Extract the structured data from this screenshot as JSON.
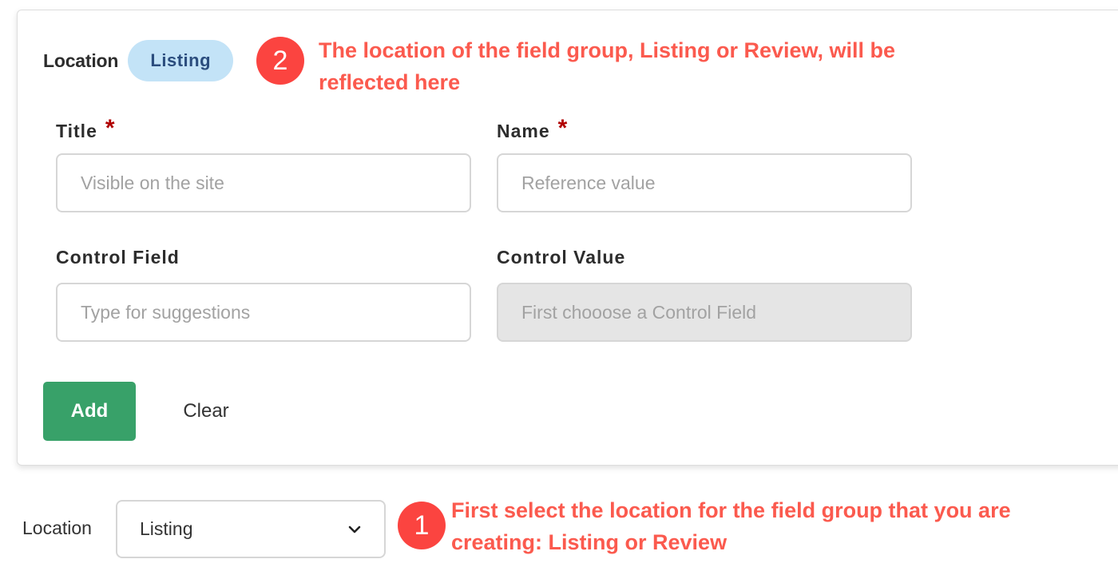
{
  "card": {
    "location_label": "Location",
    "location_badge": "Listing",
    "annotation_2": {
      "number": "2",
      "line1": "The location of the field group, Listing or Review, will be",
      "line2": "reflected here"
    },
    "fields": {
      "title": {
        "label": "Title",
        "required_mark": "*",
        "placeholder": "Visible on the site",
        "value": ""
      },
      "name": {
        "label": "Name",
        "required_mark": "*",
        "placeholder": "Reference value",
        "value": ""
      },
      "control_field": {
        "label": "Control Field",
        "placeholder": "Type for suggestions",
        "value": ""
      },
      "control_value": {
        "label": "Control Value",
        "placeholder": "First chooose a Control Field",
        "value": "",
        "disabled": true
      }
    },
    "buttons": {
      "add": "Add",
      "clear": "Clear"
    }
  },
  "bottom": {
    "location_label": "Location",
    "location_select": {
      "selected": "Listing",
      "icon": "chevron-down-icon"
    },
    "annotation_1": {
      "number": "1",
      "line1": "First select the location for the field group that you are",
      "line2": "creating: Listing or Review"
    }
  },
  "colors": {
    "accent_green": "#38a169",
    "badge_bg": "#c3e3f7",
    "badge_text": "#2b4d7e",
    "annotation_red": "#fb5a4e",
    "marker_red": "#fb4440",
    "required_red": "#b00000"
  }
}
